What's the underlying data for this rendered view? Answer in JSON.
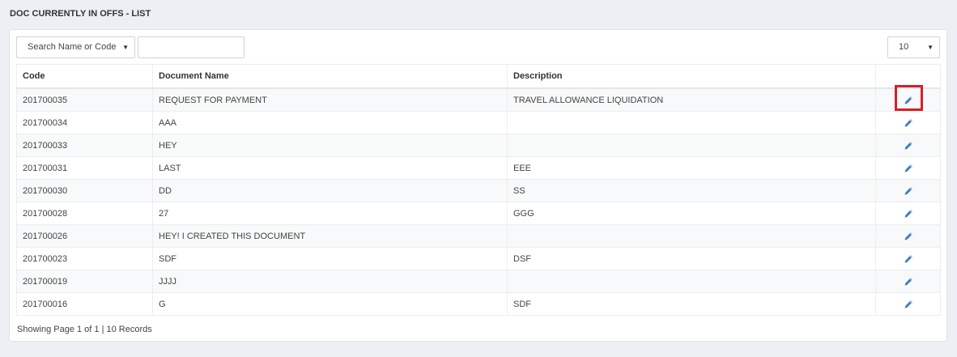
{
  "page": {
    "title": "DOC CURRENTLY IN OFFS - LIST"
  },
  "toolbar": {
    "search_by": "Search Name or Code",
    "search_value": "",
    "page_size": "10"
  },
  "table": {
    "columns": [
      "Code",
      "Document Name",
      "Description",
      ""
    ],
    "rows": [
      {
        "code": "201700035",
        "name": "REQUEST FOR PAYMENT",
        "description": "TRAVEL ALLOWANCE LIQUIDATION"
      },
      {
        "code": "201700034",
        "name": "AAA",
        "description": ""
      },
      {
        "code": "201700033",
        "name": "HEY",
        "description": ""
      },
      {
        "code": "201700031",
        "name": "LAST",
        "description": "EEE"
      },
      {
        "code": "201700030",
        "name": "DD",
        "description": "SS"
      },
      {
        "code": "201700028",
        "name": "27",
        "description": "GGG"
      },
      {
        "code": "201700026",
        "name": "HEY! I CREATED THIS DOCUMENT",
        "description": ""
      },
      {
        "code": "201700023",
        "name": "SDF",
        "description": "DSF"
      },
      {
        "code": "201700019",
        "name": "JJJJ",
        "description": ""
      },
      {
        "code": "201700016",
        "name": "G",
        "description": "SDF"
      }
    ]
  },
  "footer": {
    "info": "Showing Page 1 of 1 | 10 Records"
  },
  "icons": {
    "edit": "pencil-icon",
    "dropdown": "caret-down-icon"
  },
  "colors": {
    "edit_icon": "#3d7ebf",
    "highlight": "#d4202a",
    "background": "#eceff3"
  }
}
